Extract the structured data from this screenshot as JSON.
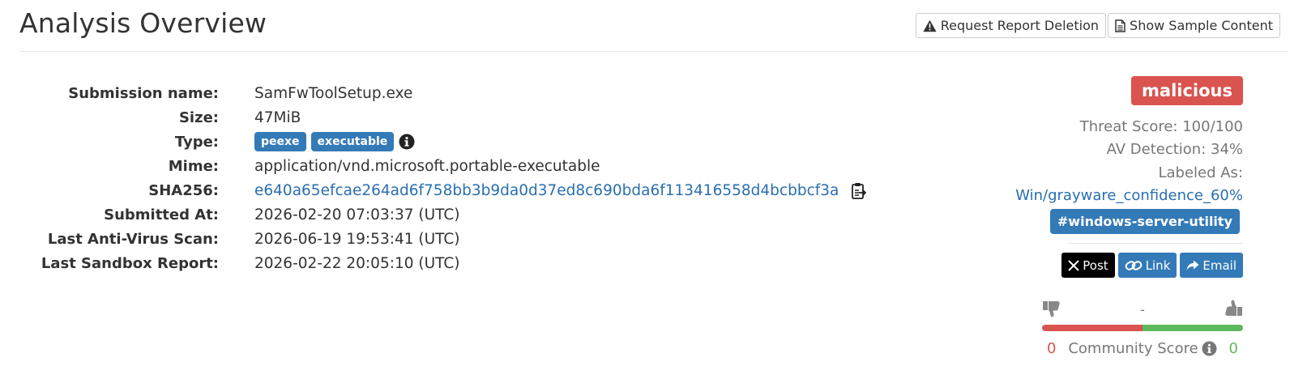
{
  "header": {
    "title": "Analysis Overview",
    "request_deletion_label": "Request Report Deletion",
    "show_sample_label": "Show Sample Content"
  },
  "details": {
    "rows": [
      {
        "label": "Submission name:",
        "value": "SamFwToolSetup.exe"
      },
      {
        "label": "Size:",
        "value": "47MiB"
      },
      {
        "label": "Type:",
        "tags": [
          "peexe",
          "executable"
        ]
      },
      {
        "label": "Mime:",
        "value": "application/vnd.microsoft.portable-executable"
      },
      {
        "label": "SHA256:",
        "value": "e640a65efcae264ad6f758bb3b9da0d37ed8c690bda6f113416558d4bcbbcf3a"
      },
      {
        "label": "Submitted At:",
        "value": "2026-02-20 07:03:37 (UTC)"
      },
      {
        "label": "Last Anti-Virus Scan:",
        "value": "2026-06-19 19:53:41 (UTC)"
      },
      {
        "label": "Last Sandbox Report:",
        "value": "2026-02-22 20:05:10 (UTC)"
      }
    ]
  },
  "side": {
    "verdict": "malicious",
    "threat_score": "Threat Score: 100/100",
    "av_detection": "AV Detection: 34%",
    "labeled_as_label": "Labeled As:",
    "labeled_as_value": "Win/grayware_confidence_60%",
    "tag": "#windows-server-utility",
    "share": {
      "post": "Post",
      "link": "Link",
      "email": "Email"
    },
    "vote_separator": "-",
    "community": {
      "negative": "0",
      "label": "Community Score",
      "positive": "0",
      "positive_fraction": 0.5
    }
  },
  "colors": {
    "link": "#2a6fb0",
    "tag": "#337ab7",
    "danger": "#d9534f",
    "success": "#5cb85c",
    "muted": "#777777"
  }
}
